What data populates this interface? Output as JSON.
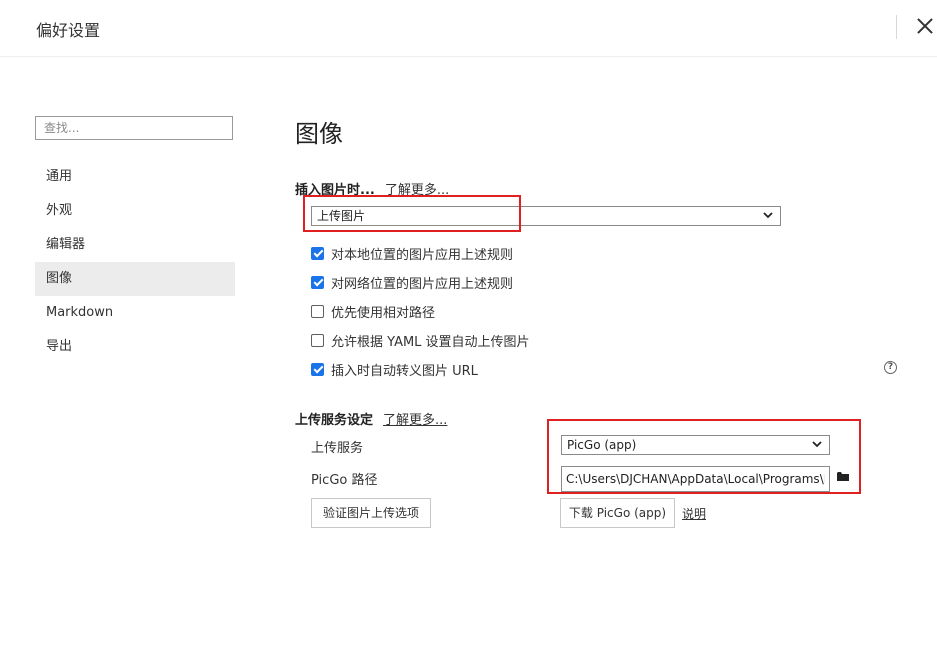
{
  "window": {
    "title": "偏好设置"
  },
  "search": {
    "placeholder": "查找..."
  },
  "sidebar": {
    "items": [
      {
        "label": "通用"
      },
      {
        "label": "外观"
      },
      {
        "label": "编辑器"
      },
      {
        "label": "图像",
        "active": true
      },
      {
        "label": "Markdown"
      },
      {
        "label": "导出"
      }
    ]
  },
  "main": {
    "heading": "图像",
    "insert": {
      "title": "插入图片时...",
      "learn_more": "了解更多...",
      "action_value": "上传图片",
      "options": [
        {
          "label": "对本地位置的图片应用上述规则",
          "checked": true
        },
        {
          "label": "对网络位置的图片应用上述规则",
          "checked": true
        },
        {
          "label": "优先使用相对路径",
          "checked": false
        },
        {
          "label": "允许根据 YAML 设置自动上传图片",
          "checked": false
        },
        {
          "label": "插入时自动转义图片 URL",
          "checked": true
        }
      ]
    },
    "upload": {
      "title": "上传服务设定",
      "learn_more": "了解更多...",
      "service_label": "上传服务",
      "service_value": "PicGo (app)",
      "path_label": "PicGo 路径",
      "path_value": "C:\\Users\\DJCHAN\\AppData\\Local\\Programs\\PicGo\\PicGo.exe",
      "verify_button": "验证图片上传选项",
      "download_button": "下载 PicGo (app)",
      "explain_link": "说明"
    }
  },
  "icons": {
    "close": "close-icon",
    "help": "help-icon",
    "folder": "folder-icon",
    "chevron": "chevron-down-icon"
  },
  "colors": {
    "checkbox_accent": "#1a73e8",
    "annotation_box": "#e02020",
    "active_nav_bg": "#ececec"
  }
}
